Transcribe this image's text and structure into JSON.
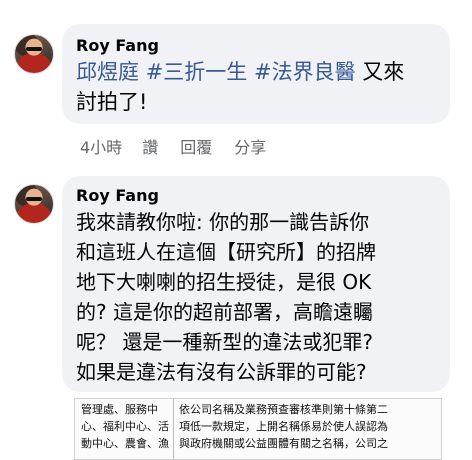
{
  "comments": [
    {
      "author": "Roy Fang",
      "hashtags": [
        "邱煜庭",
        "#三折一生",
        "#法界良醫"
      ],
      "text_after": "又來",
      "text_line2": "討拍了!",
      "meta": {
        "time": "4小時",
        "like": "讚",
        "reply": "回覆",
        "share": "分享"
      }
    },
    {
      "author": "Roy Fang",
      "lines": [
        "我來請教你啦: 你的那一識告訴你",
        "和這班人在這個【研究所】的招牌",
        "地下大喇喇的招生授徒，是很 OK",
        "的? 這是你的超前部署，高瞻遠矚",
        "呢？ 還是一種新型的違法或犯罪?",
        "如果是違法有沒有公訴罪的可能?"
      ]
    }
  ],
  "attachment": {
    "left_lines": [
      "管理處、服務中",
      "心、福利中心、活",
      "動中心、農會、漁"
    ],
    "right_lines": [
      "依公司名稱及業務預查審核準則第十條第二",
      "項低一款規定，上開名稱係易於使人誤認為",
      "與政府機關或公益團體有關之名稱，公司之"
    ]
  }
}
